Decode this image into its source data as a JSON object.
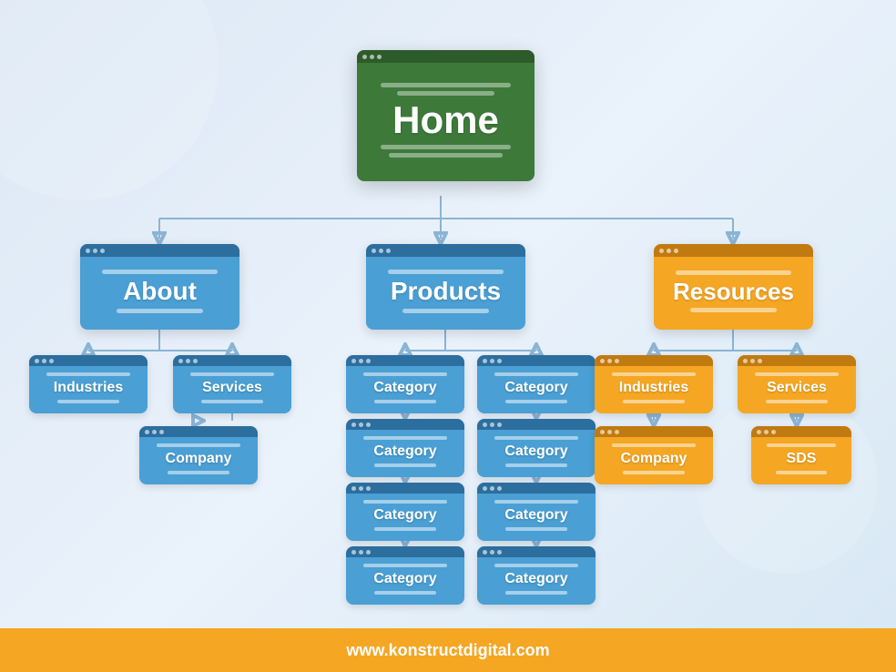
{
  "nodes": {
    "home": {
      "label": "Home"
    },
    "about": {
      "label": "About"
    },
    "products": {
      "label": "Products"
    },
    "resources": {
      "label": "Resources"
    },
    "industries_about": {
      "label": "Industries"
    },
    "services_about": {
      "label": "Services"
    },
    "company_about": {
      "label": "Company"
    },
    "category": {
      "label": "Category"
    },
    "industries_res": {
      "label": "Industries"
    },
    "services_res": {
      "label": "Services"
    },
    "company_res": {
      "label": "Company"
    },
    "sds": {
      "label": "SDS"
    }
  },
  "footer": {
    "url": "www.konstructdigital.com"
  }
}
